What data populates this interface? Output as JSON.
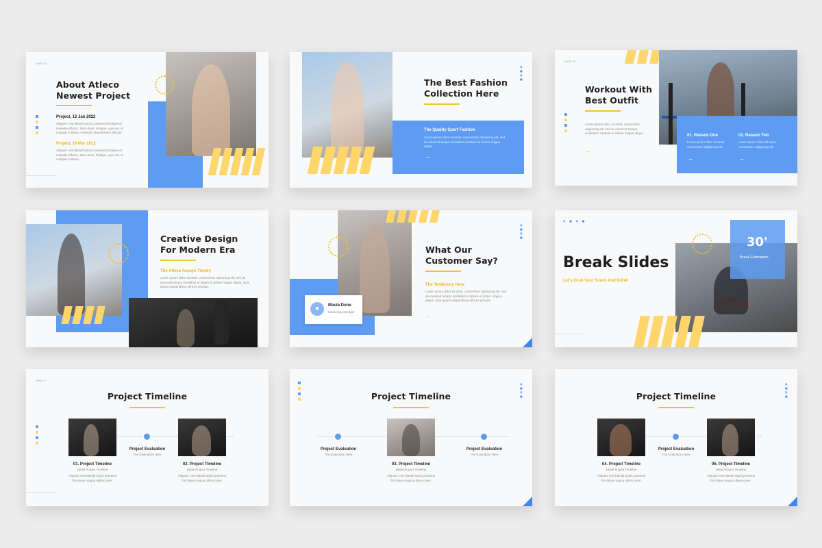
{
  "slides": {
    "about": {
      "page": "PAGE 01",
      "title_line1": "About Atleco",
      "title_line2": "Newest Project",
      "item1_label": "Project, 12 Jan 2022",
      "item1_text": "Aliquam erat blandit turpis praesent frincilique et molestie efficitur. Nam dolor, tristique, quis est, et volutpat et libero. Praesent blandit libero efficitur.",
      "item2_label": "Project, 10 Mar 2022",
      "item2_text": "Aliquam erat blandit turpis praesent frincilique et molestie efficitur. Nam dolor, tristique, quis est, et volutpat et libero."
    },
    "fashion": {
      "title_line1": "The Best Fashion",
      "title_line2": "Collection Here",
      "box_label": "The Quality Sport Fashion",
      "box_text": "Lorem ipsum dolor sit amet, consectetur adipiscing elit, sed do eiusmod tempor incididunt ut labore et dolore magna aliqua.",
      "arrow": "→"
    },
    "workout": {
      "page": "PAGE 03",
      "title_line1": "Workout With",
      "title_line2": "Best Outfit",
      "text": "Lorem ipsum dolor sit amet, consectetur adipiscing elit, sed do eiusmod tempor incididunt ut labore et dolore magna aliqua.",
      "reason1_label": "01. Reason One",
      "reason1_text": "Lorem ipsum dolor sit amet, consectetur adipiscing elit.",
      "reason2_label": "02. Reason Two",
      "reason2_text": "Lorem ipsum dolor sit amet, consectetur adipiscing elit.",
      "arrow": "→"
    },
    "creative": {
      "title_line1": "Creative Design",
      "title_line2": "For Modern Era",
      "label": "The Atleco Always Trendy",
      "text": "Lorem ipsum dolor sit amet, consectetur adipiscing elit, sed do eiusmod tempor incididunt ut labore et dolore magna aliqua. Quis ipsum suspendisse ultrices gravida."
    },
    "customer": {
      "title_line1": "What Our",
      "title_line2": "Customer Say?",
      "label": "The Testimony Here",
      "text": "Lorem ipsum dolor sit amet, consectetur adipiscing elit, sed do eiusmod tempor incididunt ut labore et dolore magna aliqua. Quis ipsum suspendisse ultrices gravida.",
      "card_name": "Maula Dune",
      "card_role": "Marketing Manager",
      "arrow": "→"
    },
    "break": {
      "title": "Break Slides",
      "subtitle": "Let's Grab Your Snack And Drink!",
      "minutes": "30'",
      "minutes_label": "Break Estimation"
    },
    "timeline1": {
      "page": "PAGE 07",
      "title": "Project Timeline",
      "mid_label": "Project Evaluation",
      "mid_sub": "The Evaluation Here",
      "item1_label": "01. Project Timeline",
      "item1_sub": "Detail Project Timeline",
      "item1_text": "Aliquam erat blandit turpis praesent frincilique magna ullamcorper.",
      "item2_label": "02. Project Timeline",
      "item2_sub": "Detail Project Timeline",
      "item2_text": "Aliquam erat blandit turpis praesent frincilique magna ullamcorper."
    },
    "timeline2": {
      "title": "Project Timeline",
      "left_label": "Project Evaluation",
      "left_sub": "The Evaluation Here",
      "right_label": "Project Evaluation",
      "right_sub": "The Evaluation Here",
      "item_label": "03. Project Timeline",
      "item_sub": "Detail Project Timeline",
      "item_text": "Aliquam erat blandit turpis praesent frincilique magna ullamcorper."
    },
    "timeline3": {
      "title": "Project Timeline",
      "mid_label": "Project Evaluation",
      "mid_sub": "The Evaluation Here",
      "item1_label": "04. Project Timeline",
      "item1_sub": "Detail Project Timeline",
      "item1_text": "Aliquam erat blandit turpis praesent frincilique magna ullamcorper.",
      "item2_label": "05. Project Timeline",
      "item2_sub": "Detail Project Timeline",
      "item2_text": "Aliquam erat blandit turpis praesent frincilique magna ullamcorper."
    }
  },
  "colors": {
    "accent_blue": "#5d9cf2",
    "accent_yellow": "#ffd66b",
    "text_dark": "#1f1f1f"
  },
  "icons": {
    "arrow": "arrow-right-icon",
    "avatar": "user-avatar-icon",
    "badge": "circular-badge-icon"
  }
}
